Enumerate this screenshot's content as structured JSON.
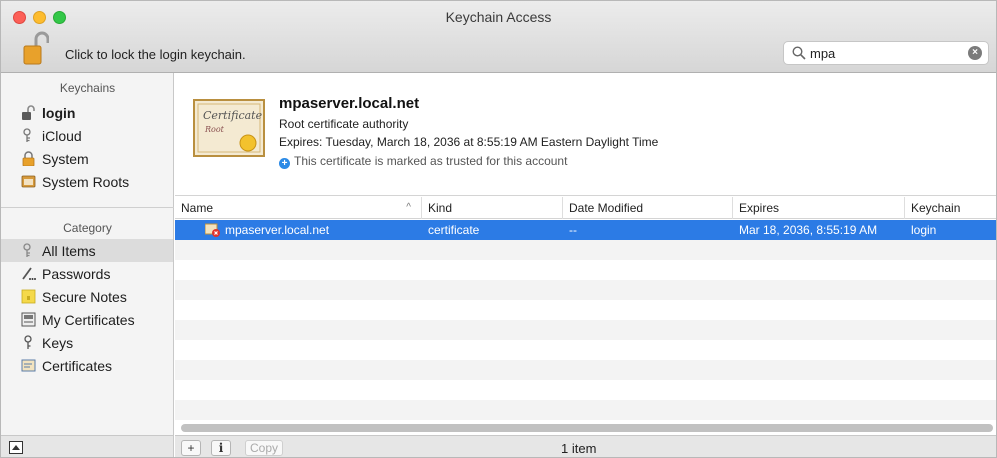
{
  "window": {
    "title": "Keychain Access"
  },
  "toolbar": {
    "lock_label": "Click to lock the login keychain."
  },
  "search": {
    "value": "mpa",
    "placeholder": "Search"
  },
  "sidebar": {
    "keychains_heading": "Keychains",
    "keychains": [
      {
        "label": "login",
        "icon": "unlocked-padlock-icon",
        "bold": true
      },
      {
        "label": "iCloud",
        "icon": "icloud-keychain-icon"
      },
      {
        "label": "System",
        "icon": "locked-padlock-icon"
      },
      {
        "label": "System Roots",
        "icon": "system-roots-icon"
      }
    ],
    "category_heading": "Category",
    "categories": [
      {
        "label": "All Items",
        "icon": "all-items-icon",
        "selected": true
      },
      {
        "label": "Passwords",
        "icon": "passwords-icon"
      },
      {
        "label": "Secure Notes",
        "icon": "secure-notes-icon"
      },
      {
        "label": "My Certificates",
        "icon": "my-certificates-icon"
      },
      {
        "label": "Keys",
        "icon": "key-icon"
      },
      {
        "label": "Certificates",
        "icon": "certificates-icon"
      }
    ]
  },
  "info": {
    "name": "mpaserver.local.net",
    "kind": "Root certificate authority",
    "expires": "Expires: Tuesday, March 18, 2036 at 8:55:19 AM Eastern Daylight Time",
    "trust": "This certificate is marked as trusted for this account"
  },
  "table": {
    "columns": [
      "Name",
      "Kind",
      "Date Modified",
      "Expires",
      "Keychain"
    ],
    "rows": [
      {
        "name": "mpaserver.local.net",
        "kind": "certificate",
        "date_modified": "--",
        "expires": "Mar 18, 2036, 8:55:19 AM",
        "keychain": "login"
      }
    ]
  },
  "bottom": {
    "add_label": "+",
    "info_label": "i",
    "copy_label": "Copy",
    "status": "1 item"
  },
  "colors": {
    "selection": "#2c7be5",
    "close": "#fc5f57",
    "minimize": "#fdbc2e",
    "maximize": "#33c748"
  }
}
